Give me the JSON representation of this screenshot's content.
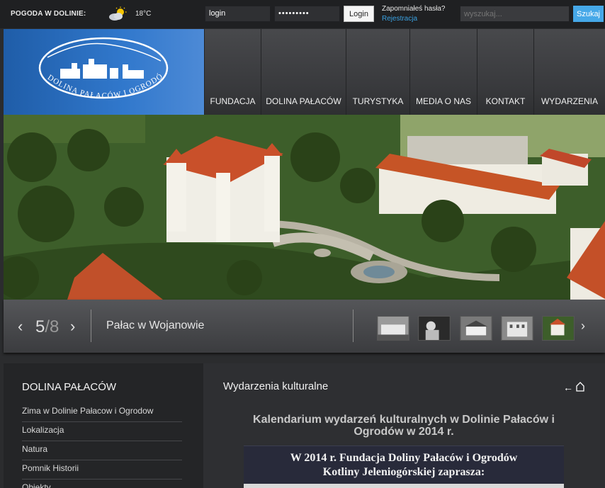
{
  "topbar": {
    "weather_label": "POGODA W DOLINIE:",
    "weather_icon": "partly-cloudy-icon",
    "temperature": "18°C",
    "login_value": "login",
    "password_value": "•••••••••",
    "login_button": "Login",
    "forgot_password": "Zapomniałeś hasła?",
    "register": "Rejestracja",
    "search_placeholder": "wyszukaj...",
    "search_button": "Szukaj"
  },
  "header": {
    "logo_text": "DOLINA PAŁACÓW I OGRODÓW",
    "nav": [
      {
        "label": "FUNDACJA"
      },
      {
        "label": "DOLINA PAŁACÓW"
      },
      {
        "label": "TURYSTYKA"
      },
      {
        "label": "MEDIA O NAS"
      },
      {
        "label": "KONTAKT"
      },
      {
        "label": "WYDARZENIA"
      }
    ]
  },
  "slider": {
    "current": "5",
    "total": "/8",
    "title": "Pałac w Wojanowie",
    "thumbnail_count": 5
  },
  "sidebar": {
    "title": "DOLINA PAŁACÓW",
    "items": [
      {
        "label": "Zima w Dolinie Pałacow i Ogrodow"
      },
      {
        "label": "Lokalizacja"
      },
      {
        "label": "Natura"
      },
      {
        "label": "Pomnik Historii"
      },
      {
        "label": "Obiekty"
      }
    ]
  },
  "main": {
    "section_title": "Wydarzenia kulturalne",
    "article_title_line1": "Kalendarium wydarzeń kulturalnych w Dolinie Pałaców i",
    "article_title_line2": "Ogrodów w 2014 r.",
    "banner_line1": "W 2014 r. Fundacja Doliny Pałaców i Ogrodów",
    "banner_line2": "Kotliny Jeleniogórskiej zaprasza:"
  },
  "colors": {
    "accent": "#46a8e8",
    "logo_bg": "#2f6fc0",
    "background": "#2b2c2e"
  }
}
